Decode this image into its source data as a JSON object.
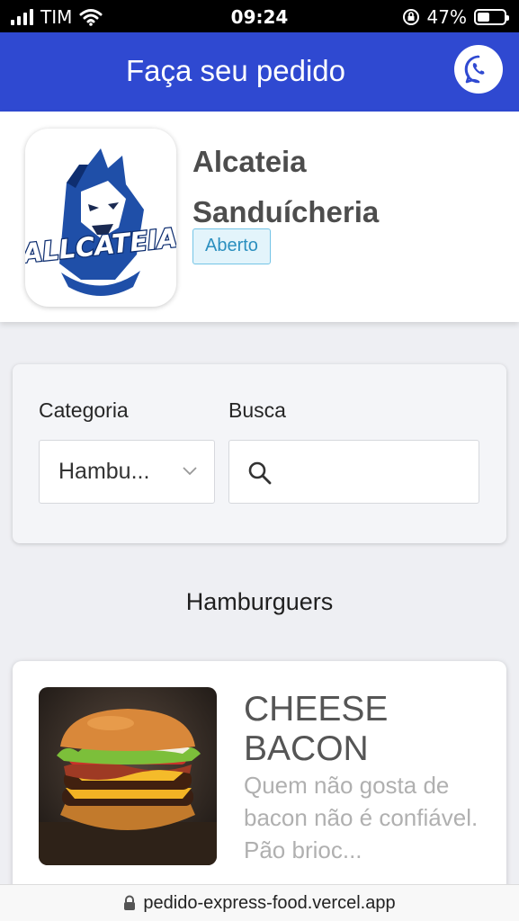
{
  "status_bar": {
    "carrier": "TIM",
    "time": "09:24",
    "battery": "47%",
    "battery_level": 0.47
  },
  "header": {
    "title": "Faça seu pedido",
    "whatsapp_icon": "whatsapp-icon",
    "brand_color": "#2f49d1"
  },
  "store": {
    "name": "Alcateia Sanduícheria",
    "status": "Aberto",
    "logo_text": "ALLCATEIA"
  },
  "filters": {
    "category_label": "Categoria",
    "category_value": "Hambu...",
    "search_label": "Busca",
    "search_value": ""
  },
  "section": {
    "title": "Hamburguers"
  },
  "products": [
    {
      "name": "CHEESE BACON",
      "description": "Quem não gosta de bacon não é confiável. Pão brioc..."
    }
  ],
  "browser": {
    "url": "pedido-express-food.vercel.app"
  }
}
